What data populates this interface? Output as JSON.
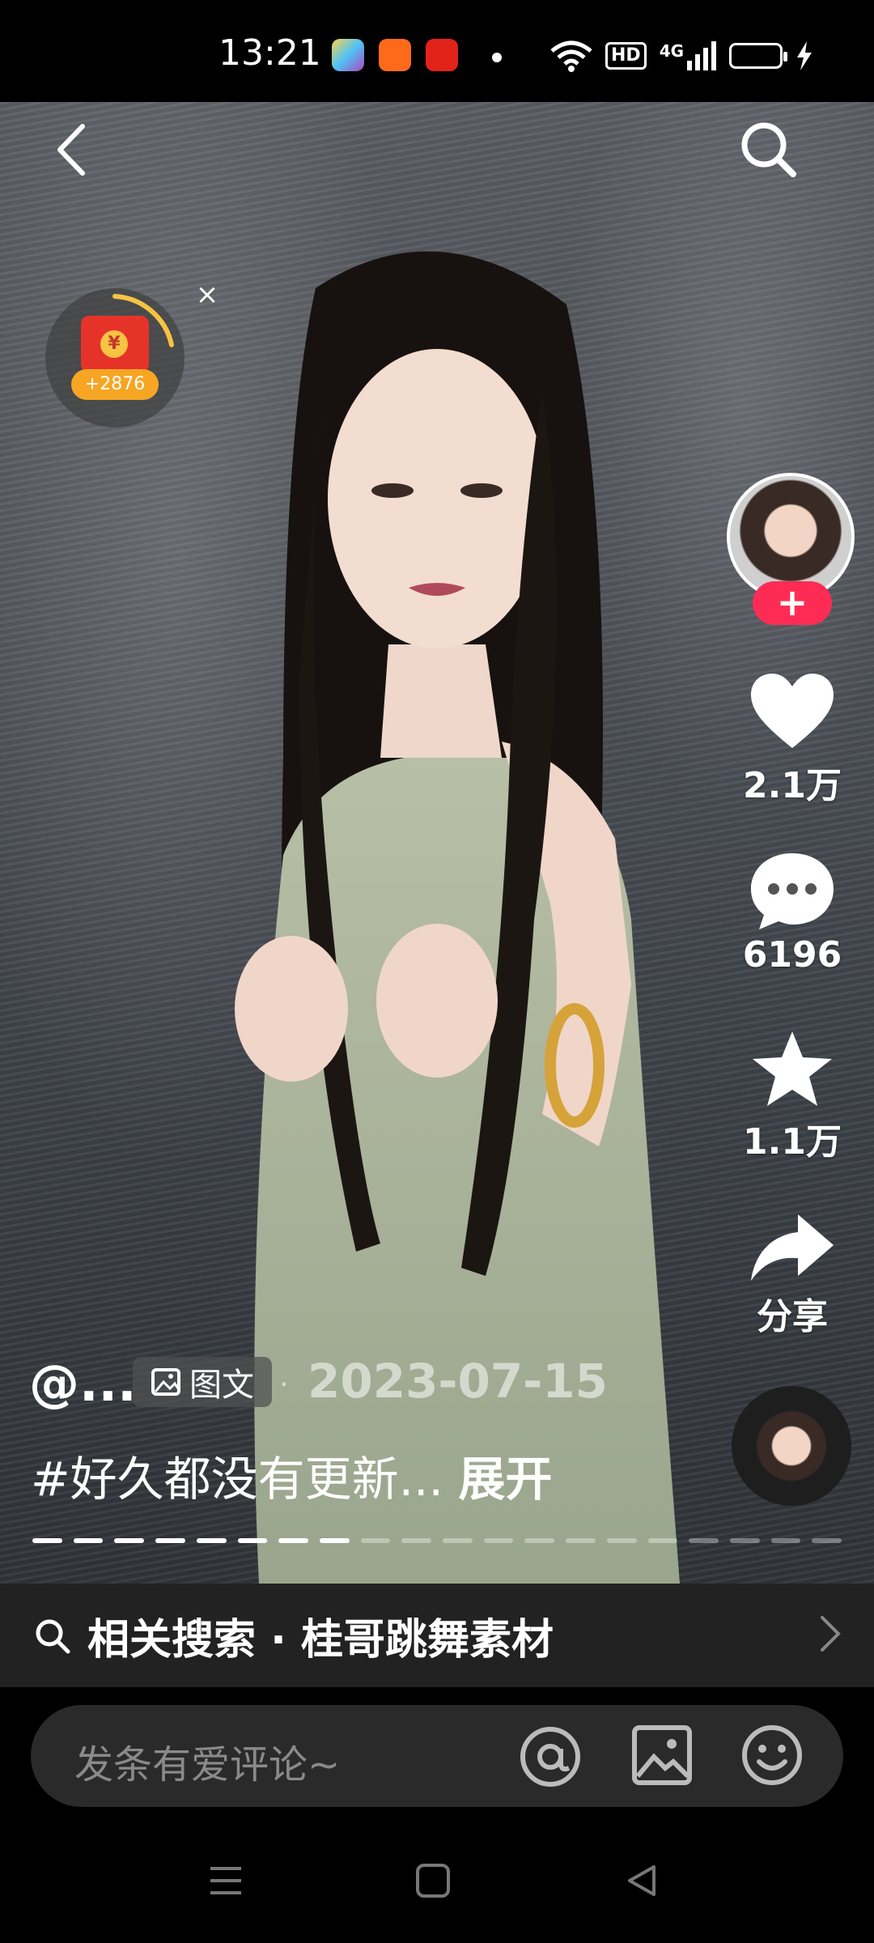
{
  "status_bar": {
    "time": "13:21",
    "hd_label": "HD",
    "network_label": "4G",
    "notification_icons": [
      "photos-app-icon",
      "multi-app-icon",
      "taobao-app-icon"
    ]
  },
  "top_bar": {
    "back_icon": "chevron-left-icon",
    "search_icon": "search-icon"
  },
  "red_packet": {
    "amount": "+2876",
    "close_label": "×",
    "coin_symbol": "¥"
  },
  "right_rail": {
    "follow_label": "+",
    "like_count": "2.1万",
    "comment_count": "6196",
    "favorite_count": "1.1万",
    "share_label": "分享"
  },
  "post": {
    "author": "@...",
    "type_label": "图文",
    "date": "2023-07-15",
    "separator": "·",
    "caption": "#好久都没有更新...",
    "expand_label": "展开",
    "progress": {
      "total": 20,
      "current": 8
    }
  },
  "related_search": {
    "text": "相关搜索 · 桂哥跳舞素材"
  },
  "comment": {
    "placeholder": "发条有爱评论~"
  },
  "colors": {
    "accent": "#fe2c55",
    "background": "#000000",
    "panel": "#222222"
  }
}
